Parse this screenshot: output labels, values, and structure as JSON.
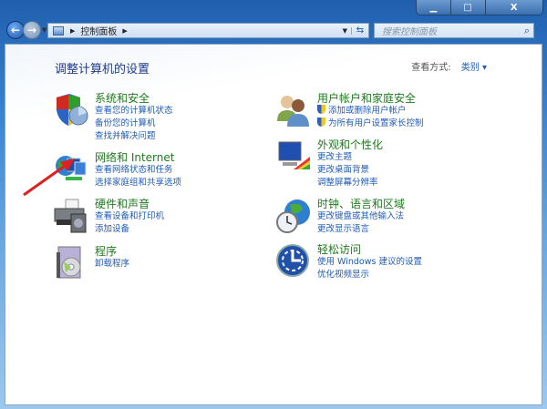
{
  "window": {
    "minimize": "▁",
    "maximize": "□",
    "close": "X"
  },
  "address": {
    "root": "控制面板",
    "search_placeholder": "搜索控制面板"
  },
  "page": {
    "title": "调整计算机的设置",
    "view_by_label": "查看方式:",
    "view_by_value": "类别"
  },
  "left": [
    {
      "heading": "系统和安全",
      "links": [
        "查看您的计算机状态",
        "备份您的计算机",
        "查找并解决问题"
      ],
      "icon": "shield-chart-icon"
    },
    {
      "heading": "网络和 Internet",
      "links": [
        "查看网络状态和任务",
        "选择家庭组和共享选项"
      ],
      "icon": "network-globe-icon"
    },
    {
      "heading": "硬件和声音",
      "links": [
        "查看设备和打印机",
        "添加设备"
      ],
      "icon": "printer-icon"
    },
    {
      "heading": "程序",
      "links": [
        "卸载程序"
      ],
      "icon": "programs-icon"
    }
  ],
  "right": [
    {
      "heading": "用户帐户和家庭安全",
      "links": [
        "添加或删除用户帐户",
        "为所有用户设置家长控制"
      ],
      "icon": "users-icon"
    },
    {
      "heading": "外观和个性化",
      "links": [
        "更改主题",
        "更改桌面背景",
        "调整屏幕分辨率"
      ],
      "icon": "monitor-palette-icon"
    },
    {
      "heading": "时钟、语言和区域",
      "links": [
        "更改键盘或其他输入法",
        "更改显示语言"
      ],
      "icon": "globe-clock-icon"
    },
    {
      "heading": "轻松访问",
      "links": [
        "使用 Windows 建议的设置",
        "优化视频显示"
      ],
      "icon": "ease-of-access-icon"
    }
  ],
  "colors": {
    "heading": "#1e7a1e",
    "link": "#1e5bb8",
    "annotation": "#e02020"
  }
}
